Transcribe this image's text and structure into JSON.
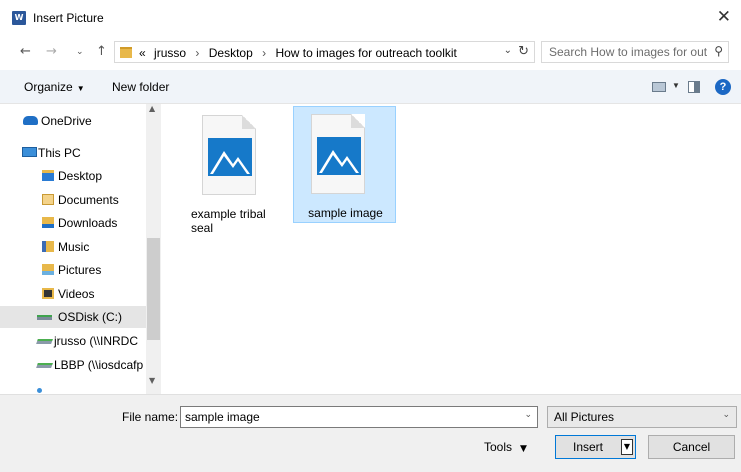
{
  "window": {
    "title": "Insert Picture",
    "app_icon": "word-icon",
    "close_glyph": "✕"
  },
  "address": {
    "overflow": "«",
    "crumbs": [
      "jrusso",
      "Desktop",
      "How to images for outreach toolkit"
    ],
    "separator": "›"
  },
  "search": {
    "placeholder": "Search How to images for out..."
  },
  "toolbar": {
    "organize_label": "Organize",
    "new_folder_label": "New folder",
    "help_glyph": "?"
  },
  "nav": {
    "items": [
      {
        "label": "OneDrive",
        "icon": "cloud-icon"
      },
      {
        "label": "This PC",
        "icon": "computer-icon"
      },
      {
        "label": "Desktop",
        "icon": "desktop-folder-icon"
      },
      {
        "label": "Documents",
        "icon": "documents-folder-icon"
      },
      {
        "label": "Downloads",
        "icon": "downloads-folder-icon"
      },
      {
        "label": "Music",
        "icon": "music-folder-icon"
      },
      {
        "label": "Pictures",
        "icon": "pictures-folder-icon"
      },
      {
        "label": "Videos",
        "icon": "videos-folder-icon"
      },
      {
        "label": "OSDisk (C:)",
        "icon": "drive-icon"
      },
      {
        "label": "jrusso (\\\\INRDC",
        "icon": "network-drive-icon"
      },
      {
        "label": "LBBP (\\\\iosdcafp",
        "icon": "network-drive-icon"
      }
    ]
  },
  "files": [
    {
      "name": "example tribal seal",
      "icon": "image-file-icon",
      "selected": false
    },
    {
      "name": "sample image",
      "icon": "image-file-icon",
      "selected": true
    }
  ],
  "footer": {
    "file_name_label": "File name:",
    "file_name_value": "sample image",
    "filter_value": "All Pictures",
    "tools_label": "Tools",
    "insert_label": "Insert",
    "cancel_label": "Cancel"
  },
  "colors": {
    "accent": "#0078d7",
    "selection": "#cce8ff",
    "image_blue": "#1679c9"
  }
}
